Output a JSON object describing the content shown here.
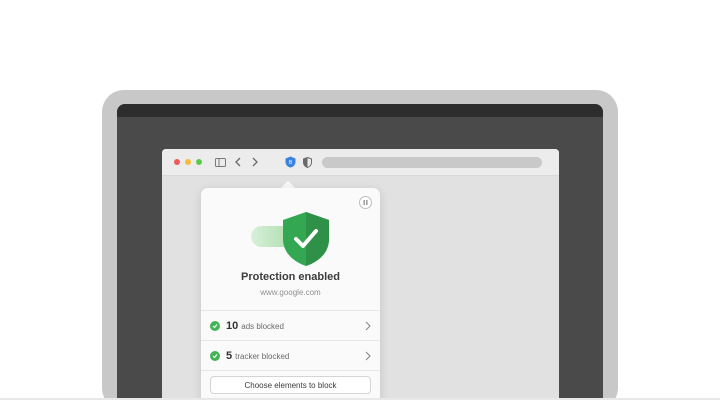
{
  "browser": {
    "traffic_lights": [
      "close",
      "minimize",
      "zoom"
    ],
    "icons": [
      "sidebar-icon",
      "back-icon",
      "forward-icon",
      "adguard-extension-icon",
      "shield-extension-icon"
    ]
  },
  "popup": {
    "title": "Protection enabled",
    "domain": "www.google.com",
    "stats": [
      {
        "count": "10",
        "label": "ads blocked"
      },
      {
        "count": "5",
        "label": "tracker blocked"
      }
    ],
    "choose_button": "Choose elements to block",
    "colors": {
      "accent": "#43b455",
      "shield": "#3aa55c"
    }
  }
}
